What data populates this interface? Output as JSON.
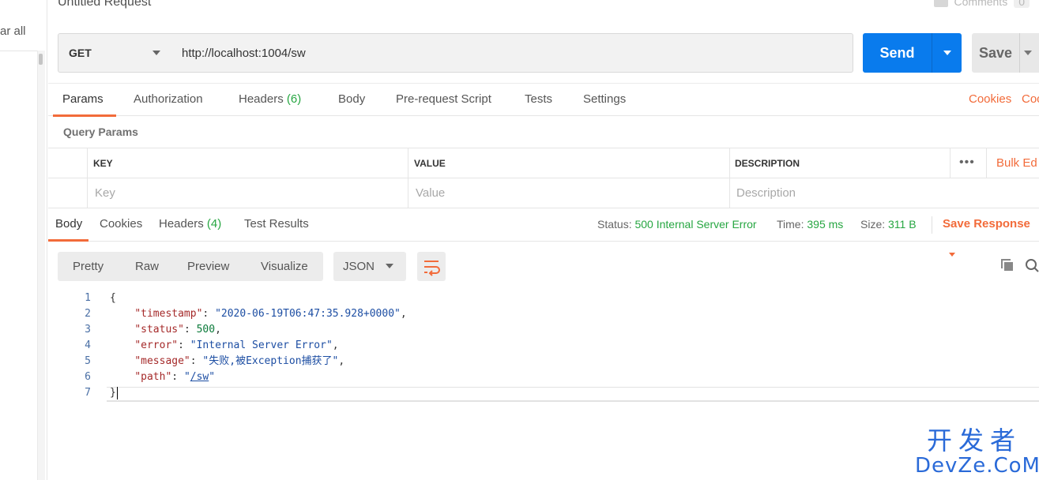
{
  "sidebar": {
    "clear_all": "ar all"
  },
  "header": {
    "title": "Untitled Request",
    "comments_label": "Comments",
    "comments_count": "0"
  },
  "request": {
    "method": "GET",
    "url": "http://localhost:1004/sw",
    "send_label": "Send",
    "save_label": "Save"
  },
  "req_tabs": {
    "params": "Params",
    "authorization": "Authorization",
    "headers": "Headers",
    "headers_count": "(6)",
    "body": "Body",
    "prerequest": "Pre-request Script",
    "tests": "Tests",
    "settings": "Settings",
    "cookies": "Cookies",
    "code": "Coc"
  },
  "query_params": {
    "title": "Query Params",
    "columns": {
      "key": "KEY",
      "value": "VALUE",
      "description": "DESCRIPTION"
    },
    "placeholders": {
      "key": "Key",
      "value": "Value",
      "description": "Description"
    },
    "more": "•••",
    "bulk_edit": "Bulk Ed"
  },
  "response": {
    "tabs": {
      "body": "Body",
      "cookies": "Cookies",
      "headers": "Headers",
      "headers_count": "(4)",
      "test_results": "Test Results"
    },
    "status_label": "Status:",
    "status_value": "500 Internal Server Error",
    "time_label": "Time:",
    "time_value": "395 ms",
    "size_label": "Size:",
    "size_value": "311 B",
    "save_response": "Save Response"
  },
  "viewer": {
    "modes": {
      "pretty": "Pretty",
      "raw": "Raw",
      "preview": "Preview",
      "visualize": "Visualize"
    },
    "format": "JSON"
  },
  "code": {
    "line_numbers": [
      "1",
      "2",
      "3",
      "4",
      "5",
      "6",
      "7"
    ],
    "open_brace": "{",
    "close_brace": "}",
    "timestamp_key": "\"timestamp\"",
    "timestamp_val": "\"2020-06-19T06:47:35.928+0000\"",
    "status_key": "\"status\"",
    "status_val": "500",
    "error_key": "\"error\"",
    "error_val": "\"Internal Server Error\"",
    "message_key": "\"message\"",
    "message_val": "\"失败,被Exception捕获了\"",
    "path_key": "\"path\"",
    "path_val": "/sw"
  },
  "watermark": {
    "line1": "开发者",
    "line2": "DevZe.CoM"
  },
  "colors": {
    "accent": "#f26b3a",
    "send": "#097bed",
    "success": "#26a641"
  }
}
